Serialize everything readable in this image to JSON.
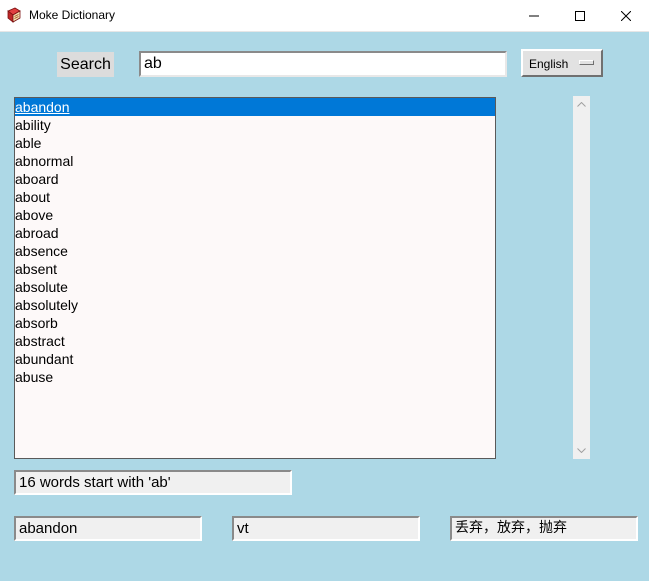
{
  "window": {
    "title": "Moke Dictionary",
    "icon": "dictionary-book-icon"
  },
  "search": {
    "label": "Search",
    "value": "ab"
  },
  "language": {
    "selected": "English"
  },
  "word_list": {
    "items": [
      "abandon",
      "ability",
      "able",
      "abnormal",
      "aboard",
      "about",
      "above",
      "abroad",
      "absence",
      "absent",
      "absolute",
      "absolutely",
      "absorb",
      "abstract",
      "abundant",
      "abuse"
    ],
    "selected_index": 0
  },
  "status": {
    "text": "16 words start with 'ab'"
  },
  "detail": {
    "word": "abandon",
    "part_of_speech": "vt",
    "meaning": "丢弃，放弃，抛弃"
  },
  "colors": {
    "background": "#add8e6",
    "selection": "#0078d7"
  }
}
